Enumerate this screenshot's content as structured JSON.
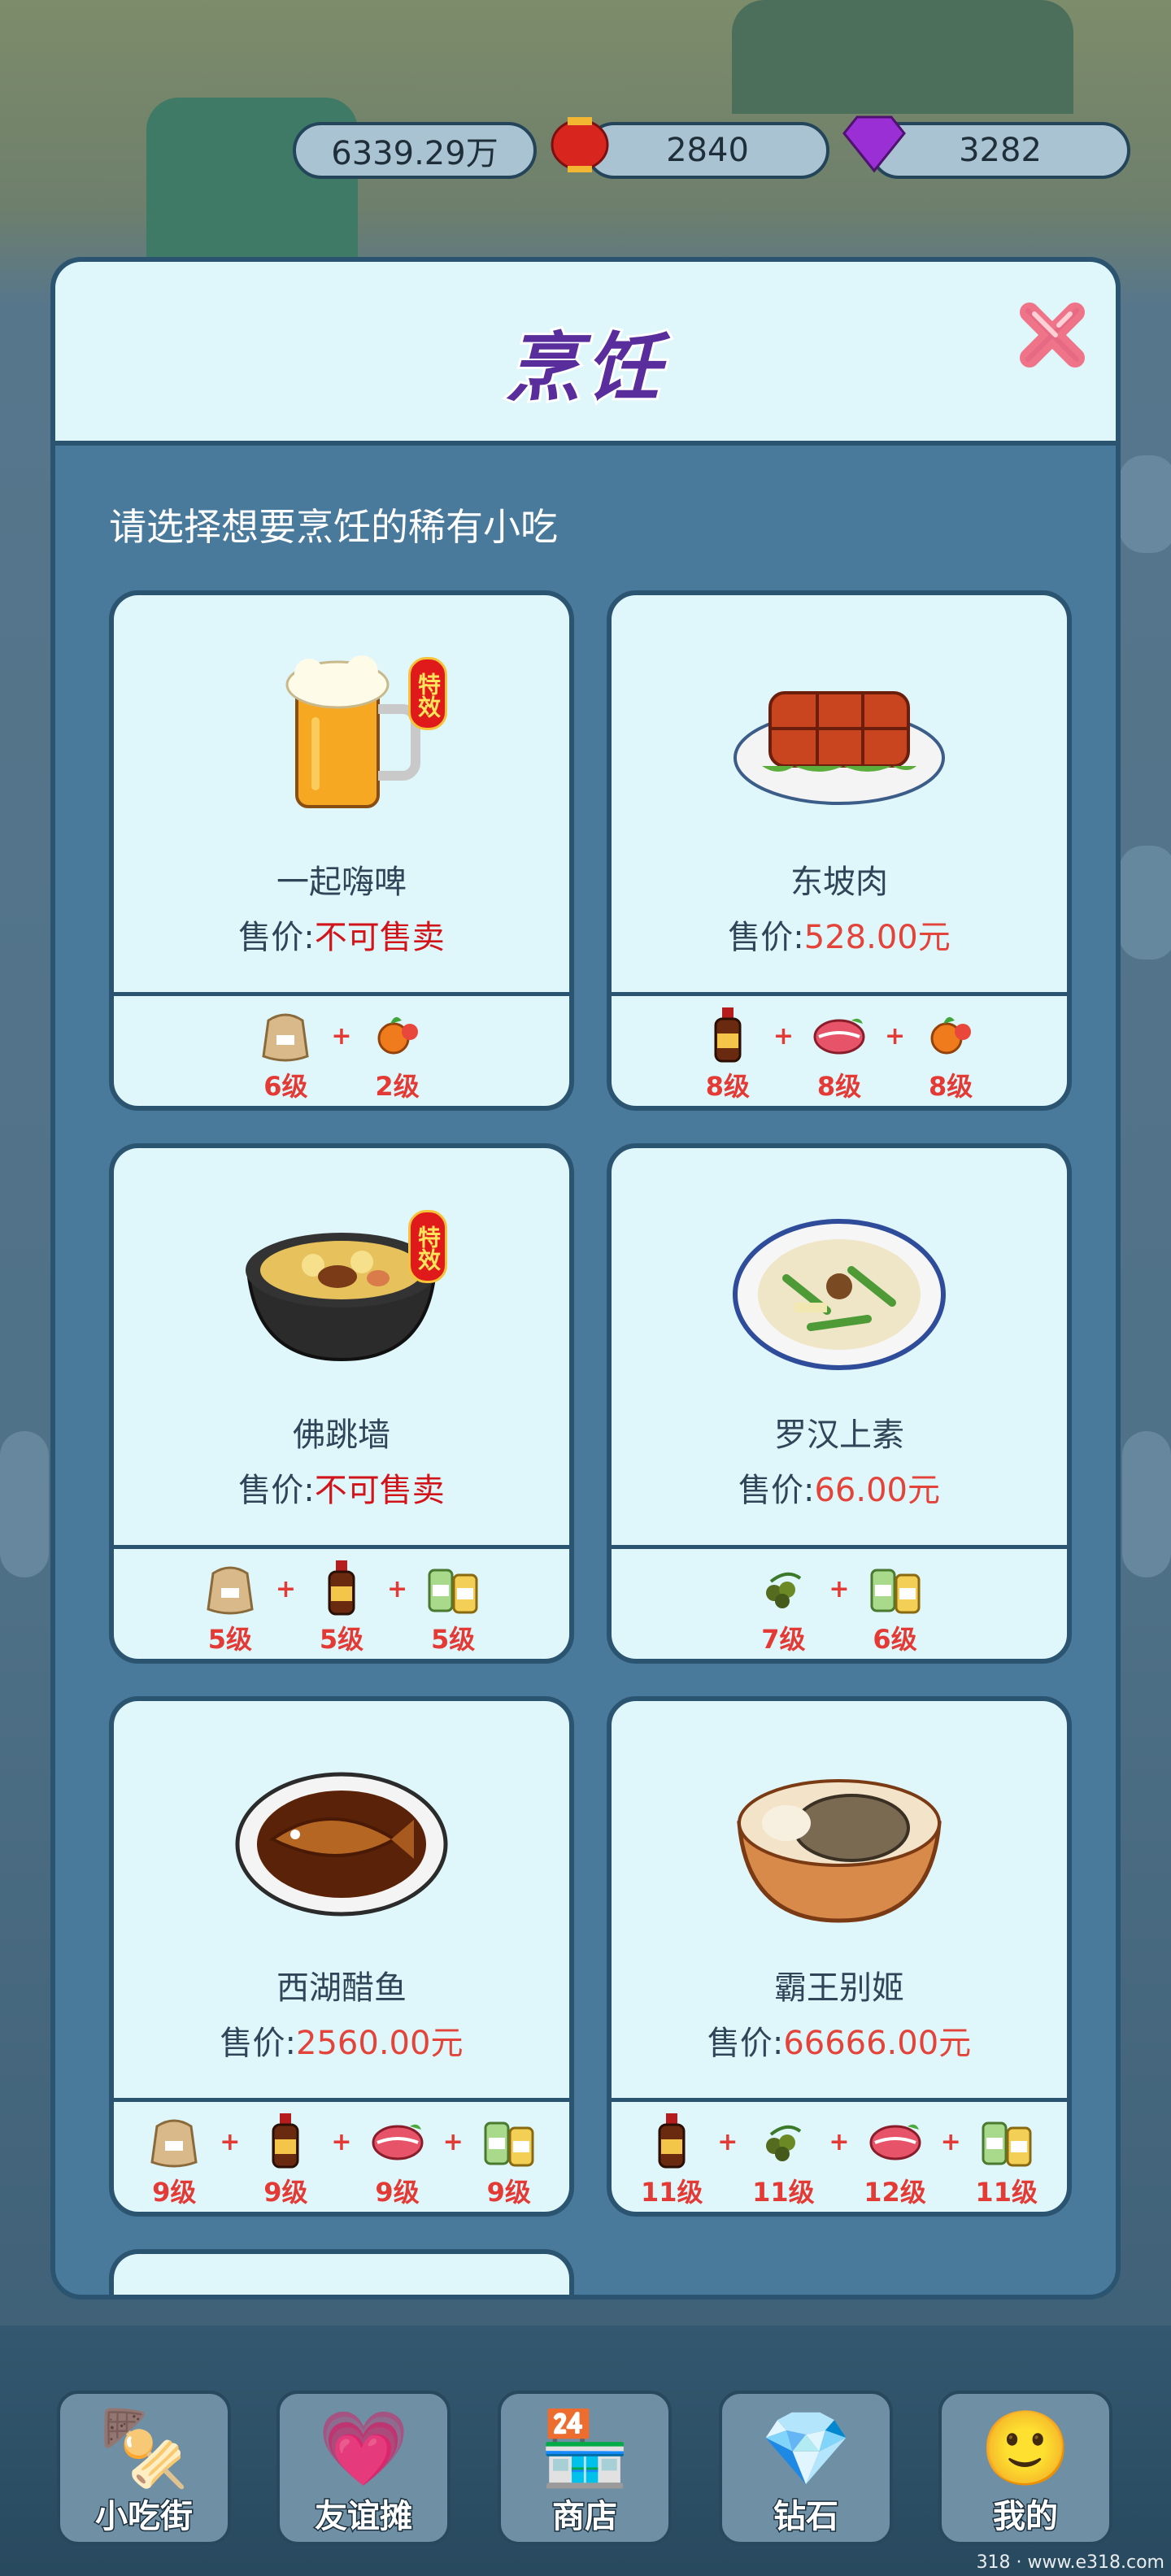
{
  "resources": {
    "coins": "6339.29万",
    "lanterns": "2840",
    "diamonds": "3282"
  },
  "dialog": {
    "title": "烹饪",
    "prompt": "请选择想要烹饪的稀有小吃"
  },
  "price_prefix": "售价:",
  "special_label": "特效",
  "dishes": [
    {
      "name": "一起嗨啤",
      "price": "不可售卖",
      "special": true,
      "icon": "beer-mug",
      "ingredients": [
        {
          "icon": "flour-sack",
          "level": "6级"
        },
        {
          "icon": "vegetables",
          "level": "2级"
        }
      ]
    },
    {
      "name": "东坡肉",
      "price": "528.00元",
      "special": false,
      "icon": "braised-pork",
      "ingredients": [
        {
          "icon": "soy-sauce-bottle",
          "level": "8级"
        },
        {
          "icon": "raw-meat",
          "level": "8级"
        },
        {
          "icon": "vegetables",
          "level": "8级"
        }
      ]
    },
    {
      "name": "佛跳墙",
      "price": "不可售卖",
      "special": true,
      "icon": "clay-pot-soup",
      "ingredients": [
        {
          "icon": "flour-sack",
          "level": "5级"
        },
        {
          "icon": "soy-sauce-bottle",
          "level": "5级"
        },
        {
          "icon": "seasoning-jars",
          "level": "5级"
        }
      ]
    },
    {
      "name": "罗汉上素",
      "price": "66.00元",
      "special": false,
      "icon": "vegetable-plate",
      "ingredients": [
        {
          "icon": "green-peppercorns",
          "level": "7级"
        },
        {
          "icon": "seasoning-jars",
          "level": "6级"
        }
      ]
    },
    {
      "name": "西湖醋鱼",
      "price": "2560.00元",
      "special": false,
      "icon": "vinegar-fish",
      "ingredients": [
        {
          "icon": "flour-sack",
          "level": "9级"
        },
        {
          "icon": "soy-sauce-bottle",
          "level": "9级"
        },
        {
          "icon": "raw-meat",
          "level": "9级"
        },
        {
          "icon": "seasoning-jars",
          "level": "9级"
        }
      ]
    },
    {
      "name": "霸王别姬",
      "price": "66666.00元",
      "special": false,
      "icon": "turtle-soup",
      "ingredients": [
        {
          "icon": "soy-sauce-bottle",
          "level": "11级"
        },
        {
          "icon": "green-peppercorns",
          "level": "11级"
        },
        {
          "icon": "raw-meat",
          "level": "12级"
        },
        {
          "icon": "seasoning-jars",
          "level": "11级"
        }
      ]
    }
  ],
  "nav": [
    {
      "label": "小吃街",
      "icon": "skewer-icon"
    },
    {
      "label": "友谊摊",
      "icon": "heart-stall-icon"
    },
    {
      "label": "商店",
      "icon": "shop-icon"
    },
    {
      "label": "钻石",
      "icon": "diamond-icon"
    },
    {
      "label": "我的",
      "icon": "profile-icon"
    }
  ],
  "watermark": "318 · www.e318.com"
}
